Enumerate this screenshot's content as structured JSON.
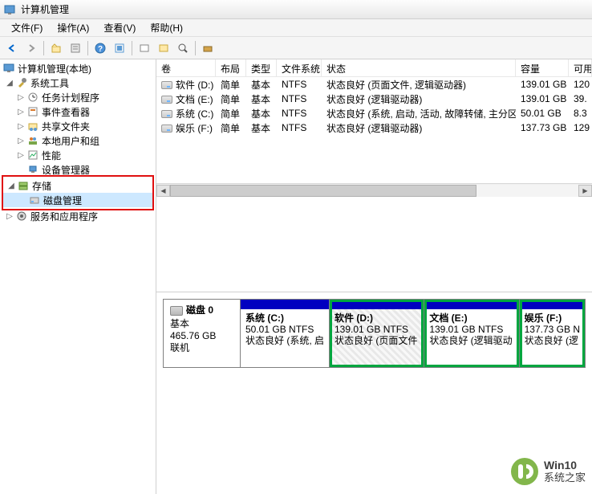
{
  "window": {
    "title": "计算机管理"
  },
  "menu": {
    "file": "文件(F)",
    "action": "操作(A)",
    "view": "查看(V)",
    "help": "帮助(H)"
  },
  "tree": {
    "root": "计算机管理(本地)",
    "system_tools": "系统工具",
    "task_scheduler": "任务计划程序",
    "event_viewer": "事件查看器",
    "shared_folders": "共享文件夹",
    "local_users": "本地用户和组",
    "performance": "性能",
    "device_manager": "设备管理器",
    "storage": "存储",
    "disk_management": "磁盘管理",
    "services_apps": "服务和应用程序"
  },
  "columns": {
    "volume": "卷",
    "layout": "布局",
    "type": "类型",
    "filesystem": "文件系统",
    "status": "状态",
    "capacity": "容量",
    "free": "可用"
  },
  "volumes": [
    {
      "name": "软件 (D:)",
      "layout": "简单",
      "type": "基本",
      "fs": "NTFS",
      "status": "状态良好 (页面文件, 逻辑驱动器)",
      "capacity": "139.01 GB",
      "free": "120"
    },
    {
      "name": "文档 (E:)",
      "layout": "简单",
      "type": "基本",
      "fs": "NTFS",
      "status": "状态良好 (逻辑驱动器)",
      "capacity": "139.01 GB",
      "free": "39."
    },
    {
      "name": "系统 (C:)",
      "layout": "简单",
      "type": "基本",
      "fs": "NTFS",
      "status": "状态良好 (系统, 启动, 活动, 故障转储, 主分区)",
      "capacity": "50.01 GB",
      "free": "8.3"
    },
    {
      "name": "娱乐 (F:)",
      "layout": "简单",
      "type": "基本",
      "fs": "NTFS",
      "status": "状态良好 (逻辑驱动器)",
      "capacity": "137.73 GB",
      "free": "129"
    }
  ],
  "disk": {
    "label": "磁盘 0",
    "type": "基本",
    "size": "465.76 GB",
    "status": "联机",
    "partitions": [
      {
        "name": "系统 (C:)",
        "info": "50.01 GB NTFS",
        "status": "状态良好 (系统, 启"
      },
      {
        "name": "软件 (D:)",
        "info": "139.01 GB NTFS",
        "status": "状态良好 (页面文件"
      },
      {
        "name": "文档 (E:)",
        "info": "139.01 GB NTFS",
        "status": "状态良好 (逻辑驱动"
      },
      {
        "name": "娱乐 (F:)",
        "info": "137.73 GB N",
        "status": "状态良好 (逻"
      }
    ]
  },
  "watermark": {
    "line1": "Win10",
    "line2": "系统之家"
  }
}
